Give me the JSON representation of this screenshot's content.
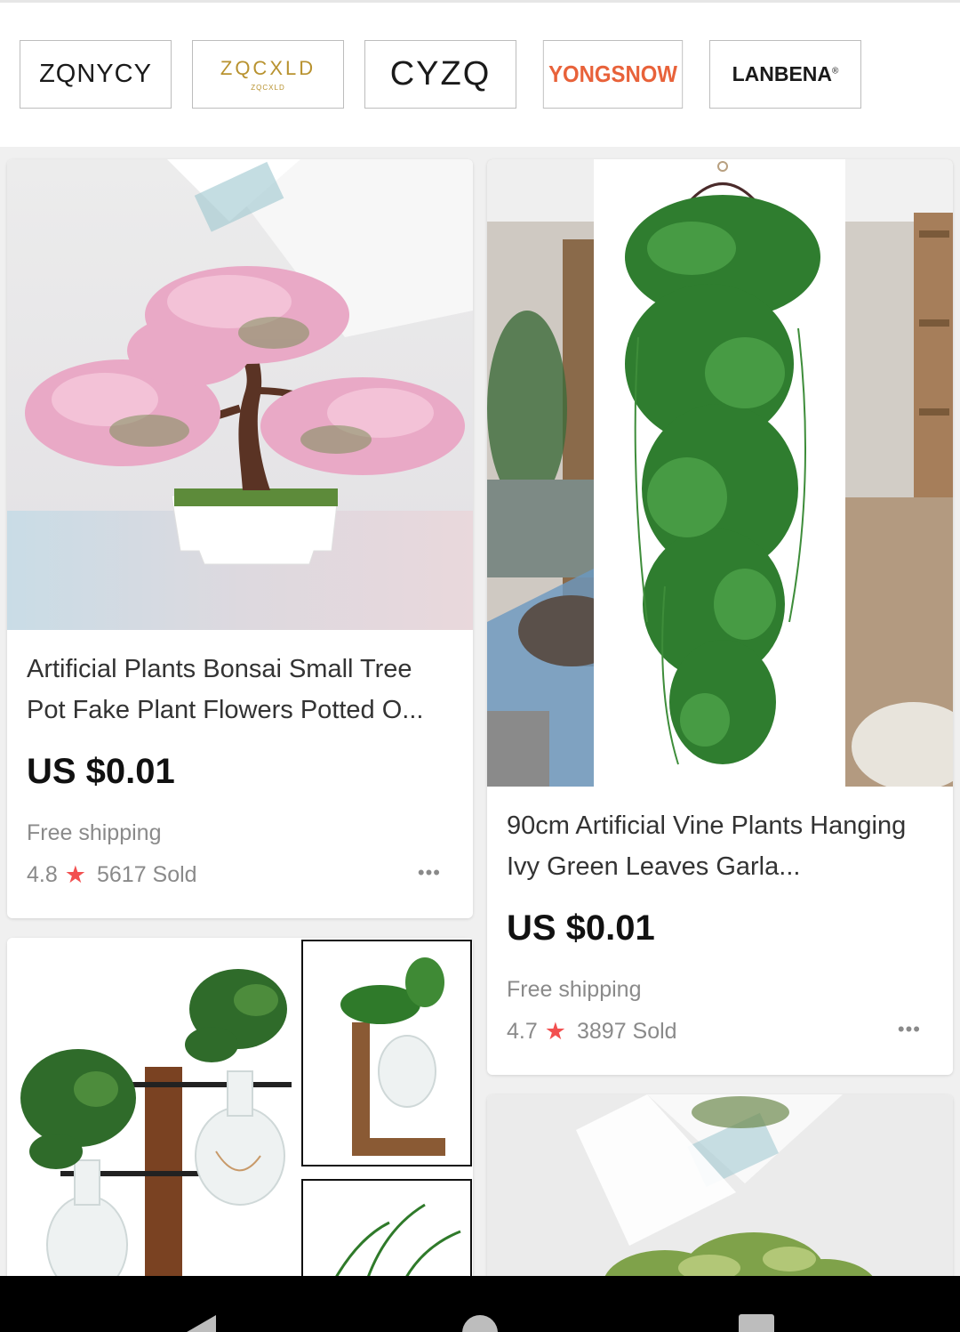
{
  "brands": [
    {
      "name": "ZQNYCY"
    },
    {
      "name": "ZQCXLD",
      "sub": "ZQCXLD"
    },
    {
      "name": "CYZQ"
    },
    {
      "name": "YONGSNOW"
    },
    {
      "name": "LANBENA",
      "mark": "®"
    }
  ],
  "products": [
    {
      "title": "Artificial Plants Bonsai Small Tree Pot Fake Plant Flowers Potted O...",
      "price": "US $0.01",
      "shipping": "Free shipping",
      "rating": "4.8",
      "sold": "5617 Sold",
      "more": "•••"
    },
    {
      "title": "90cm Artificial Vine Plants Hanging Ivy Green Leaves Garla...",
      "price": "US $0.01",
      "shipping": "Free shipping",
      "rating": "4.7",
      "sold": "3897 Sold",
      "more": "•••"
    }
  ],
  "colors": {
    "star": "#f25050",
    "background": "#f0f0f0",
    "card": "#ffffff"
  },
  "icons": {
    "star": "★",
    "nav_back": "triangle",
    "nav_home": "circle",
    "nav_recent": "square"
  }
}
